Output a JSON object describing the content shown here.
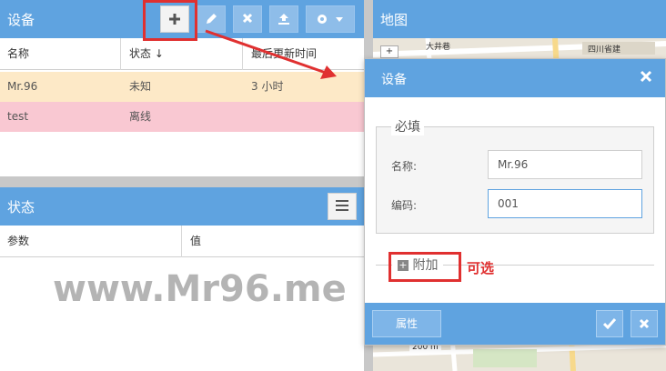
{
  "devices_panel": {
    "title": "设备",
    "toolbar": {
      "add": "+",
      "delete": "×"
    },
    "columns": [
      "名称",
      "状态 ↓",
      "最后更新时间"
    ],
    "rows": [
      {
        "name": "Mr.96",
        "status": "未知",
        "updated": "3 小时",
        "bg": "#fde9c7"
      },
      {
        "name": "test",
        "status": "离线",
        "updated": "",
        "bg": "#f9c8d2"
      }
    ]
  },
  "status_panel": {
    "title": "状态",
    "columns": [
      "参数",
      "值"
    ]
  },
  "map_panel": {
    "title": "地图",
    "labels": [
      "大井巷",
      "四川省建",
      "200 m"
    ]
  },
  "device_dialog": {
    "title": "设备",
    "required_legend": "必填",
    "name_label": "名称:",
    "name_value": "Mr.96",
    "code_label": "编码:",
    "code_value": "001",
    "addon_label": "附加",
    "attributes_button": "属性"
  },
  "annotations": {
    "optional_note": "可选",
    "watermark": "www.Mr96.me"
  },
  "colors": {
    "header_blue": "#5fa3e0",
    "highlight_red": "#e03030",
    "row_unknown": "#fde9c7",
    "row_offline": "#f9c8d2"
  }
}
